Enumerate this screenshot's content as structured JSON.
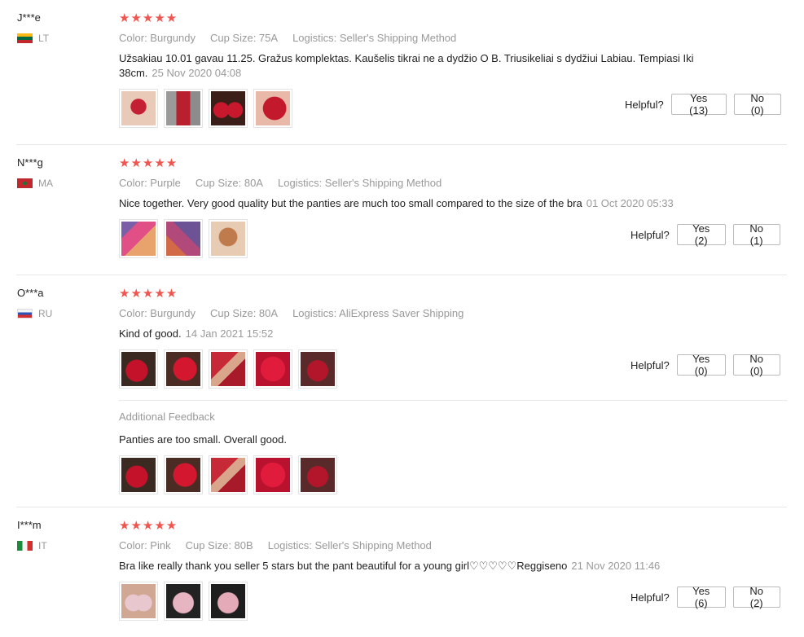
{
  "labels": {
    "helpful": "Helpful?",
    "additional_feedback": "Additional Feedback"
  },
  "colors": {
    "star": "#f0554f",
    "muted": "#999999"
  },
  "reviews": [
    {
      "user": "J***e",
      "country": "LT",
      "stars": "★★★★★",
      "color": "Color: Burgundy",
      "cup": "Cup Size: 75A",
      "logistics": "Logistics: Seller's Shipping Method",
      "text": "Užsakiau 10.01 gavau 11.25. Gražus komplektas. Kaušelis tikrai ne a dydžio O B. Triusikeliai s dydžiui Labiau. Tempiasi Iki 38cm.",
      "date": "25 Nov 2020 04:08",
      "yes": "Yes (13)",
      "no": "No (0)"
    },
    {
      "user": "N***g",
      "country": "MA",
      "stars": "★★★★★",
      "color": "Color: Purple",
      "cup": "Cup Size: 80A",
      "logistics": "Logistics: Seller's Shipping Method",
      "text": "Nice together. Very good quality but the panties are much too small compared to the size of the bra",
      "date": "01 Oct 2020 05:33",
      "yes": "Yes (2)",
      "no": "No (1)"
    },
    {
      "user": "O***a",
      "country": "RU",
      "stars": "★★★★★",
      "color": "Color: Burgundy",
      "cup": "Cup Size: 80A",
      "logistics": "Logistics: AliExpress Saver Shipping",
      "text": "Kind of good.",
      "date": "14 Jan 2021 15:52",
      "yes": "Yes (0)",
      "no": "No (0)",
      "additional_text": "Panties are too small. Overall good."
    },
    {
      "user": "I***m",
      "country": "IT",
      "stars": "★★★★★",
      "color": "Color: Pink",
      "cup": "Cup Size: 80B",
      "logistics": "Logistics: Seller's Shipping Method",
      "text": "Bra like really thank you seller 5 stars but the pant beautiful for a young girl♡♡♡♡♡Reggiseno",
      "date": "21 Nov 2020 11:46",
      "yes": "Yes (6)",
      "no": "No (2)"
    }
  ]
}
